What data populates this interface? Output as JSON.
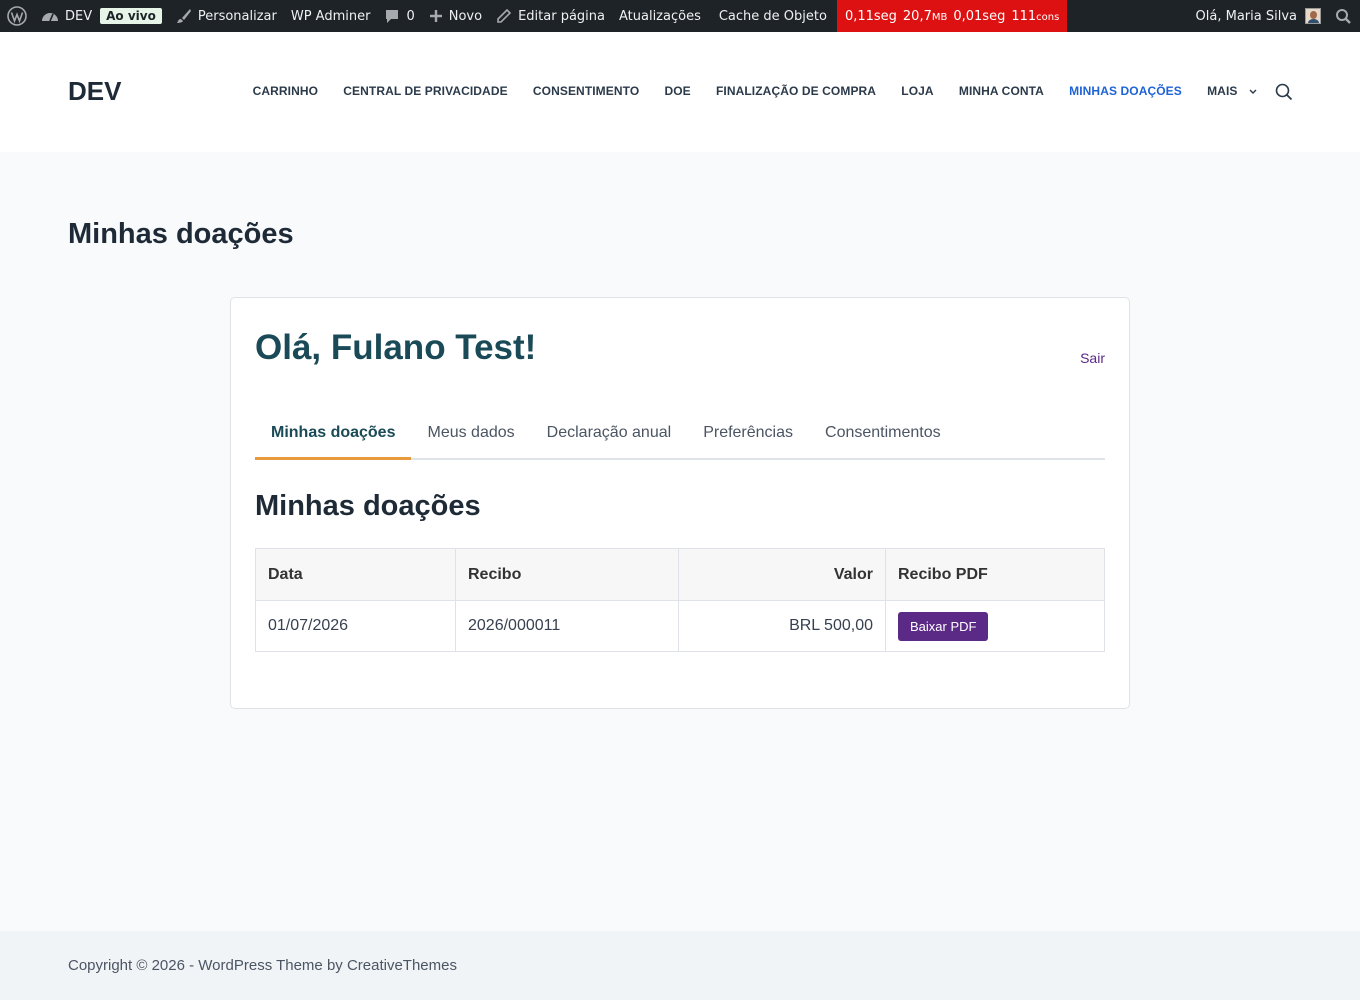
{
  "adminbar": {
    "site_name": "DEV",
    "live_badge": "Ao vivo",
    "customize": "Personalizar",
    "wp_adminer": "WP Adminer",
    "comments_count": "0",
    "new": "Novo",
    "edit_page": "Editar página",
    "updates": "Atualizações",
    "object_cache": "Cache de Objeto",
    "perf": {
      "time1": "0,11seg",
      "memory": "20,7",
      "memory_unit": "MB",
      "time2": "0,01seg",
      "queries": "111",
      "queries_unit": "cons"
    },
    "greeting": "Olá, Maria Silva"
  },
  "header": {
    "site_title": "DEV",
    "nav": [
      {
        "label": "CARRINHO"
      },
      {
        "label": "CENTRAL DE PRIVACIDADE"
      },
      {
        "label": "CONSENTIMENTO"
      },
      {
        "label": "DOE"
      },
      {
        "label": "FINALIZAÇÃO DE COMPRA"
      },
      {
        "label": "LOJA"
      },
      {
        "label": "MINHA CONTA"
      },
      {
        "label": "MINHAS DOAÇÕES"
      },
      {
        "label": "MAIS"
      }
    ],
    "active_color": "#1e63d6"
  },
  "main": {
    "page_title": "Minhas doações",
    "greeting": "Olá, Fulano Test!",
    "logout": "Sair",
    "tabs": [
      {
        "label": "Minhas doações",
        "active": true
      },
      {
        "label": "Meus dados"
      },
      {
        "label": "Declaração anual"
      },
      {
        "label": "Preferências"
      },
      {
        "label": "Consentimentos"
      }
    ],
    "section_title": "Minhas doações",
    "table": {
      "headers": [
        "Data",
        "Recibo",
        "Valor",
        "Recibo PDF"
      ],
      "rows": [
        {
          "date": "01/07/2026",
          "receipt": "2026/000011",
          "value": "BRL 500,00",
          "button": "Baixar PDF"
        }
      ]
    },
    "colors": {
      "accent": "#5b2a86",
      "tab_underline": "#e69a3c",
      "heading": "#1a4a57"
    }
  },
  "footer": {
    "copyright": "Copyright © 2026 - WordPress Theme by CreativeThemes"
  }
}
